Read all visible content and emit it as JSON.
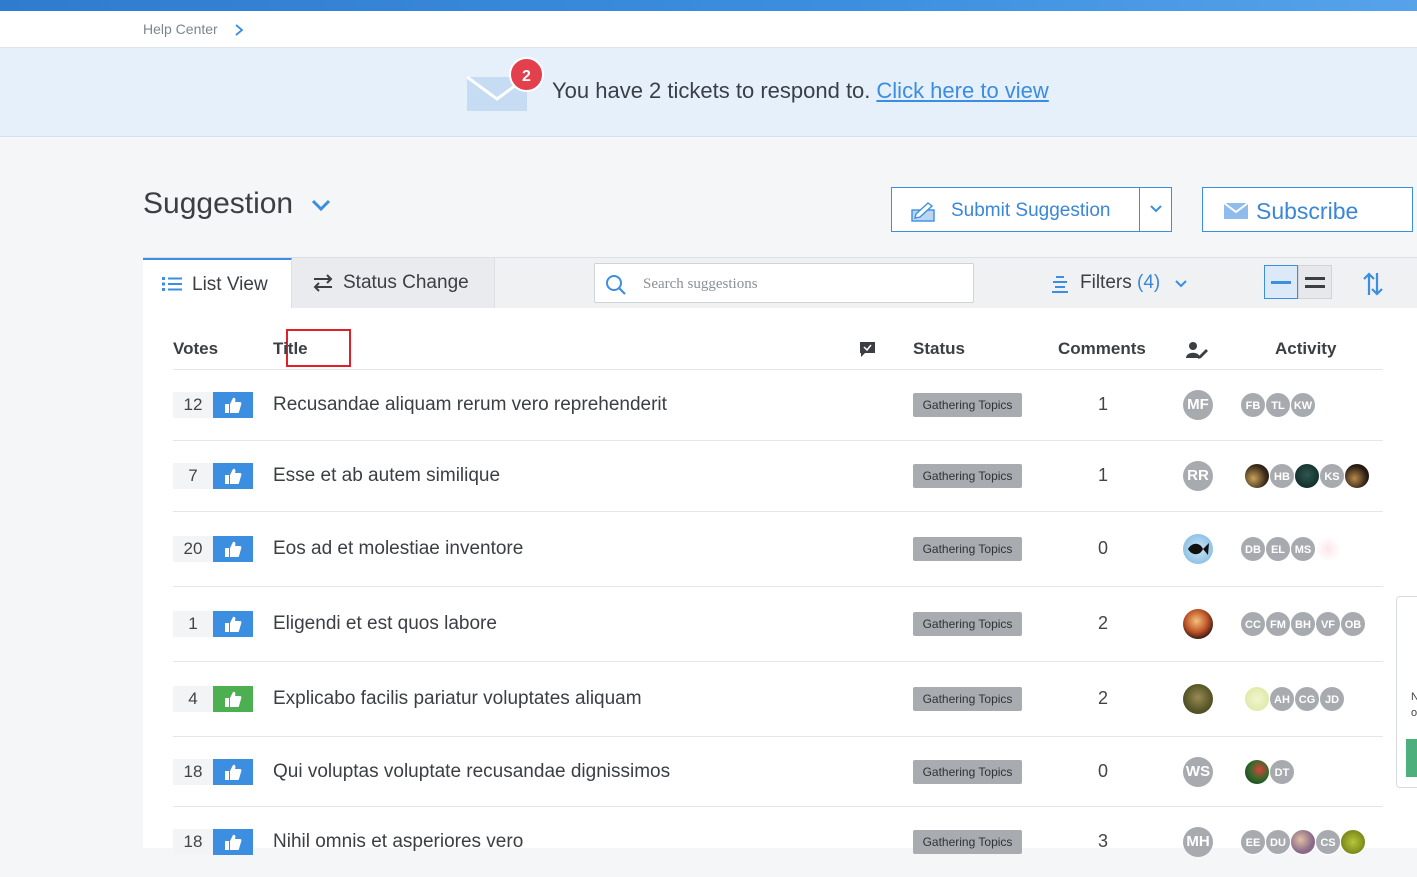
{
  "breadcrumb": {
    "label": "Help Center"
  },
  "banner": {
    "badge_count": "2",
    "text": "You have 2 tickets to respond to.",
    "link": "Click here to view"
  },
  "page": {
    "title": "Suggestion"
  },
  "actions": {
    "submit_label": "Submit Suggestion",
    "subscribe_label": "Subscribe"
  },
  "tabs": [
    {
      "label": "List View"
    },
    {
      "label": "Status Change"
    }
  ],
  "search": {
    "placeholder": "Search suggestions"
  },
  "filters": {
    "label": "Filters",
    "count": "(4)"
  },
  "columns": {
    "votes": "Votes",
    "title": "Title",
    "status": "Status",
    "comments": "Comments",
    "activity": "Activity"
  },
  "rows": [
    {
      "votes": "12",
      "title": "Recusandae aliquam rerum vero reprehenderit",
      "status": "Gathering Topics",
      "comments": "1",
      "assignee": "MF",
      "activity": [
        "FB",
        "TL",
        "KW"
      ]
    },
    {
      "votes": "7",
      "title": "Esse et ab autem similique",
      "status": "Gathering Topics",
      "comments": "1",
      "assignee": "RR",
      "activity": [
        "",
        "HB",
        "",
        "KS",
        ""
      ]
    },
    {
      "votes": "20",
      "title": "Eos ad et molestiae inventore",
      "status": "Gathering Topics",
      "comments": "0",
      "assignee": "",
      "activity": [
        "DB",
        "EL",
        "MS",
        ""
      ]
    },
    {
      "votes": "1",
      "title": "Eligendi et est quos labore",
      "status": "Gathering Topics",
      "comments": "2",
      "assignee": "",
      "activity": [
        "CC",
        "FM",
        "BH",
        "VF",
        "OB"
      ]
    },
    {
      "votes": "4",
      "title": "Explicabo facilis pariatur voluptates aliquam",
      "status": "Gathering Topics",
      "comments": "2",
      "assignee": "",
      "activity": [
        "",
        "AH",
        "CG",
        "JD"
      ]
    },
    {
      "votes": "18",
      "title": "Qui voluptas voluptate recusandae dignissimos",
      "status": "Gathering Topics",
      "comments": "0",
      "assignee": "WS",
      "activity": [
        "",
        "DT"
      ]
    },
    {
      "votes": "18",
      "title": "Nihil omnis et asperiores vero",
      "status": "Gathering Topics",
      "comments": "3",
      "assignee": "MH",
      "activity": [
        "EE",
        "DU",
        "",
        "CS",
        ""
      ]
    }
  ],
  "colors": {
    "accent": "#3c8fe0",
    "badge": "#e3404d",
    "vote_blue": "#3c8fe0",
    "vote_green": "#4caf50",
    "status_bg": "#a8acb0",
    "highlight_box": "#e01f26"
  },
  "side_widget": {
    "line1": "N",
    "line2": "o"
  }
}
